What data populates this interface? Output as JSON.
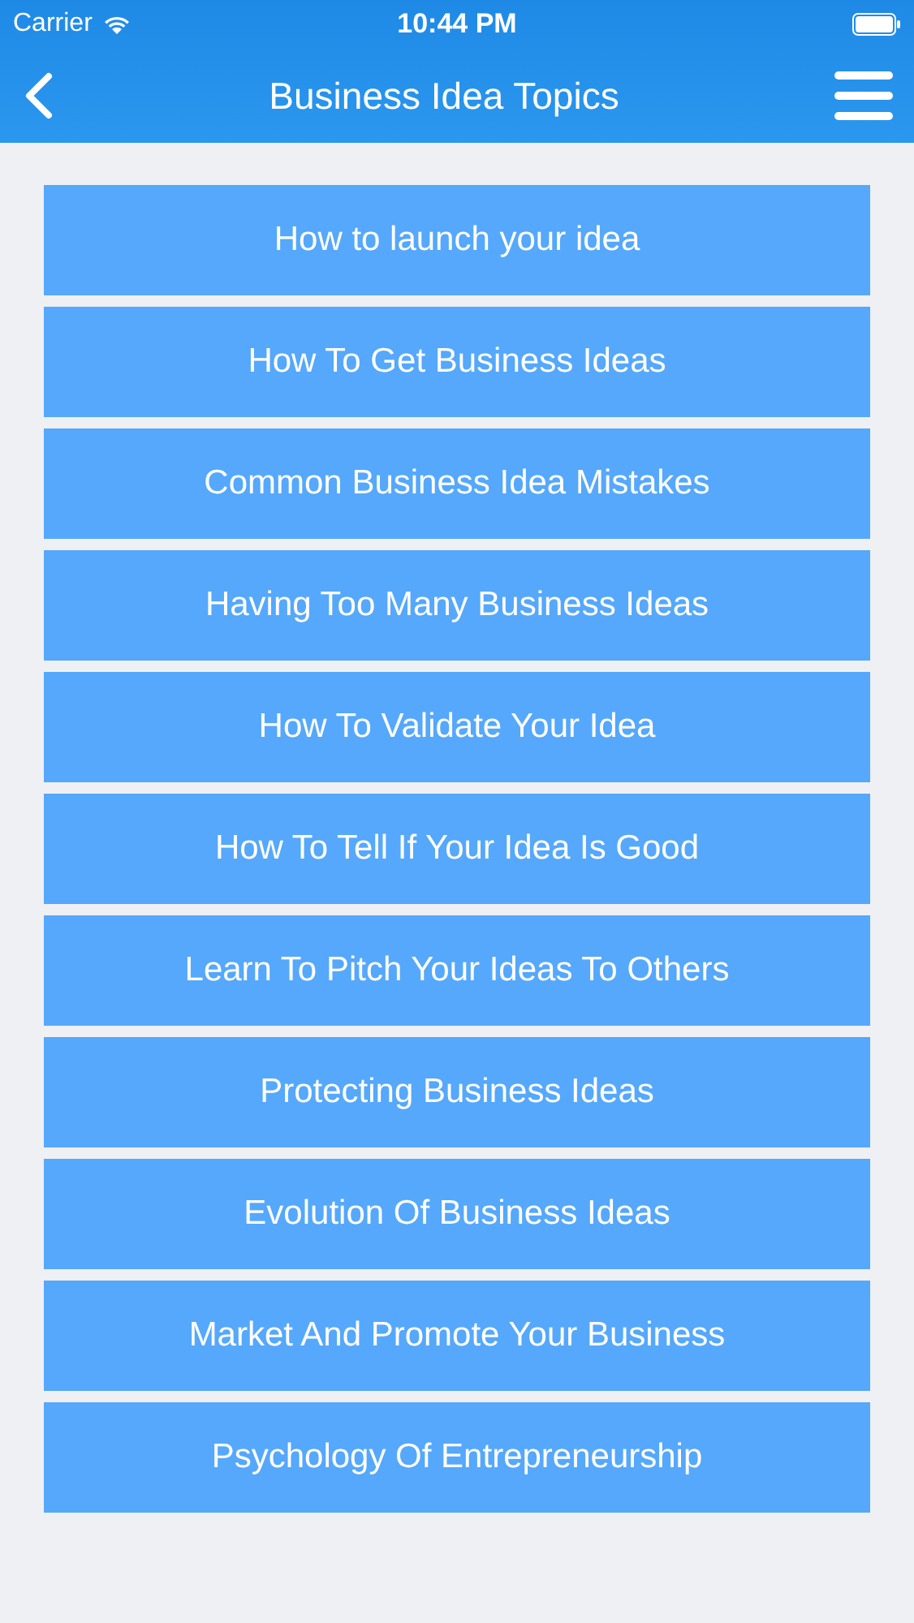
{
  "status_bar": {
    "carrier": "Carrier",
    "time": "10:44 PM"
  },
  "nav_bar": {
    "title": "Business Idea Topics"
  },
  "topics": [
    {
      "label": "How to launch your idea"
    },
    {
      "label": "How To Get Business Ideas"
    },
    {
      "label": "Common Business Idea Mistakes"
    },
    {
      "label": "Having Too Many Business Ideas"
    },
    {
      "label": "How To Validate Your Idea"
    },
    {
      "label": "How To Tell If Your Idea Is Good"
    },
    {
      "label": "Learn To Pitch Your Ideas To Others"
    },
    {
      "label": "Protecting Business Ideas"
    },
    {
      "label": "Evolution Of Business Ideas"
    },
    {
      "label": "Market And Promote Your Business"
    },
    {
      "label": "Psychology Of Entrepreneurship"
    }
  ]
}
